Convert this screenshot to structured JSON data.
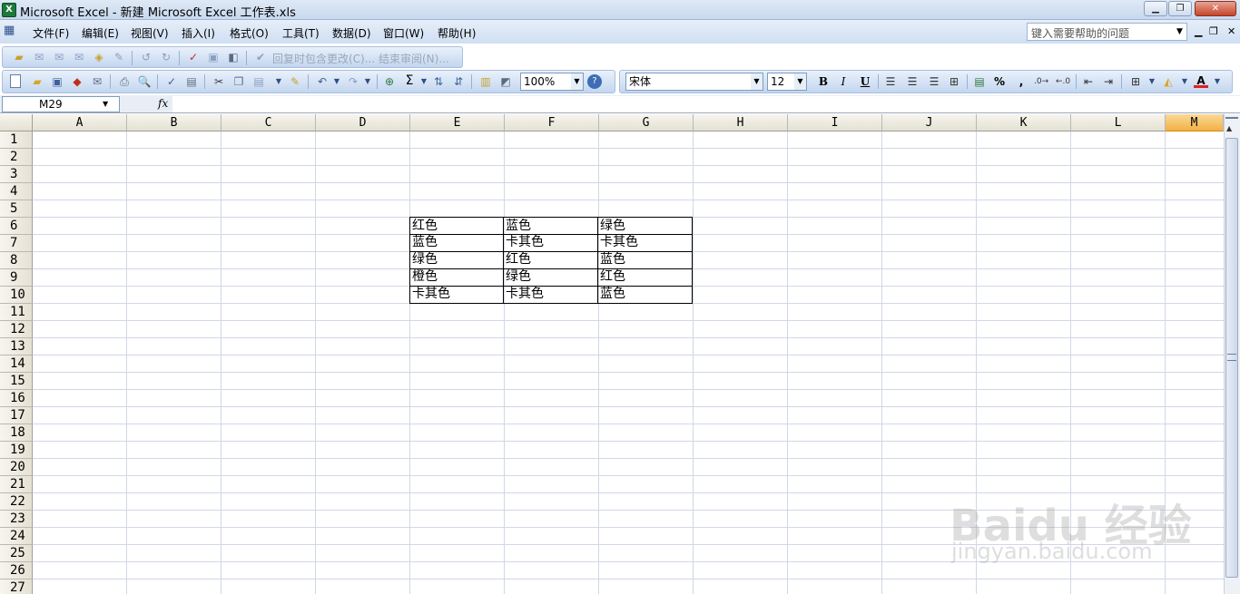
{
  "window": {
    "title": "Microsoft Excel - 新建 Microsoft Excel 工作表.xls",
    "min": "▁",
    "max": "❐",
    "close": "✕"
  },
  "menu": {
    "items": [
      "文件(F)",
      "编辑(E)",
      "视图(V)",
      "插入(I)",
      "格式(O)",
      "工具(T)",
      "数据(D)",
      "窗口(W)",
      "帮助(H)"
    ],
    "help_placeholder": "键入需要帮助的问题"
  },
  "toolbar": {
    "review_text": "回复时包含更改(C)...  结束审阅(N)...",
    "zoom": "100%",
    "font_name": "宋体",
    "font_size": "12",
    "sum_glyph": "Σ",
    "bold": "B",
    "italic": "I",
    "underline": "U",
    "percent": "%",
    "comma": ","
  },
  "formula_bar": {
    "name_box": "M29",
    "fx_label": "fx",
    "value": ""
  },
  "sheet": {
    "columns": [
      "A",
      "B",
      "C",
      "D",
      "E",
      "F",
      "G",
      "H",
      "I",
      "J",
      "K",
      "L",
      "M"
    ],
    "active_column": "M",
    "rows": [
      "1",
      "2",
      "3",
      "4",
      "5",
      "6",
      "7",
      "8",
      "9",
      "10",
      "11",
      "12",
      "13",
      "14",
      "15",
      "16",
      "17",
      "18",
      "19",
      "20",
      "21",
      "22",
      "23",
      "24",
      "25",
      "26",
      "27"
    ],
    "table": [
      [
        "红色",
        "蓝色",
        "绿色"
      ],
      [
        "蓝色",
        "卡其色",
        "卡其色"
      ],
      [
        "绿色",
        "红色",
        "蓝色"
      ],
      [
        "橙色",
        "绿色",
        "红色"
      ],
      [
        "卡其色",
        "卡其色",
        "蓝色"
      ]
    ]
  },
  "watermark": {
    "logo": "Baidu 经验",
    "url": "jingyan.baidu.com"
  },
  "colors": {
    "grid": "#d0d7e5",
    "header": "#e5e1d3",
    "active_header": "#f3b142",
    "toolbar": "#c3d6ef"
  }
}
